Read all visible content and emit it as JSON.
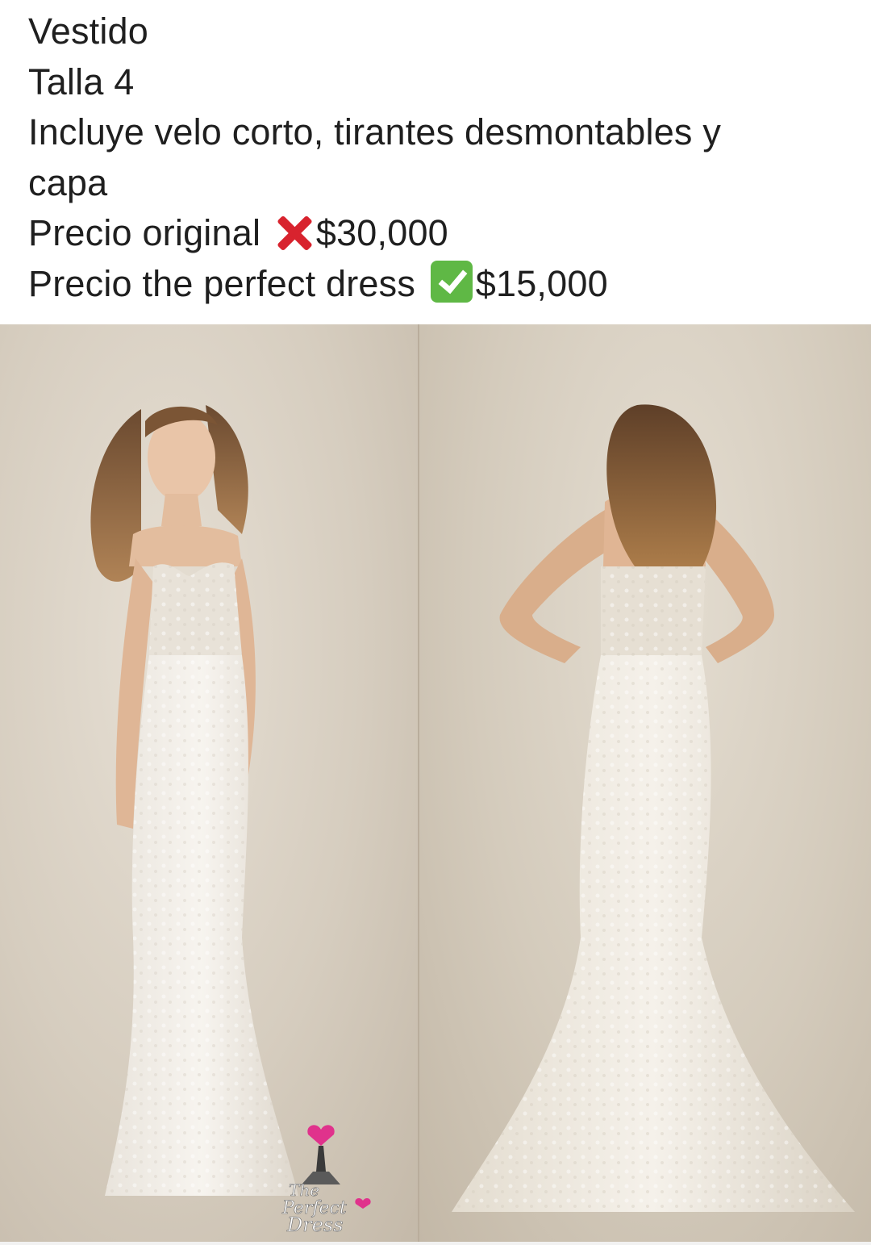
{
  "post": {
    "line1": "Vestido",
    "line2": "Talla 4",
    "line3": "Incluye velo corto, tirantes desmontables y",
    "line4": "capa",
    "price_original_label": "Precio original ",
    "price_original_value": "$30,000",
    "price_offer_label": "Precio the perfect dress ",
    "price_offer_value": "$15,000",
    "icons": {
      "original": "cross-mark-icon",
      "offer": "check-mark-button-icon"
    }
  },
  "photo": {
    "panels": [
      "front-view",
      "back-view"
    ],
    "logo_text": "The Perfect Dress"
  },
  "colors": {
    "text": "#1f1f1f",
    "cross": "#d8232e",
    "check": "#5fb845",
    "logo_pink": "#e0328c"
  }
}
